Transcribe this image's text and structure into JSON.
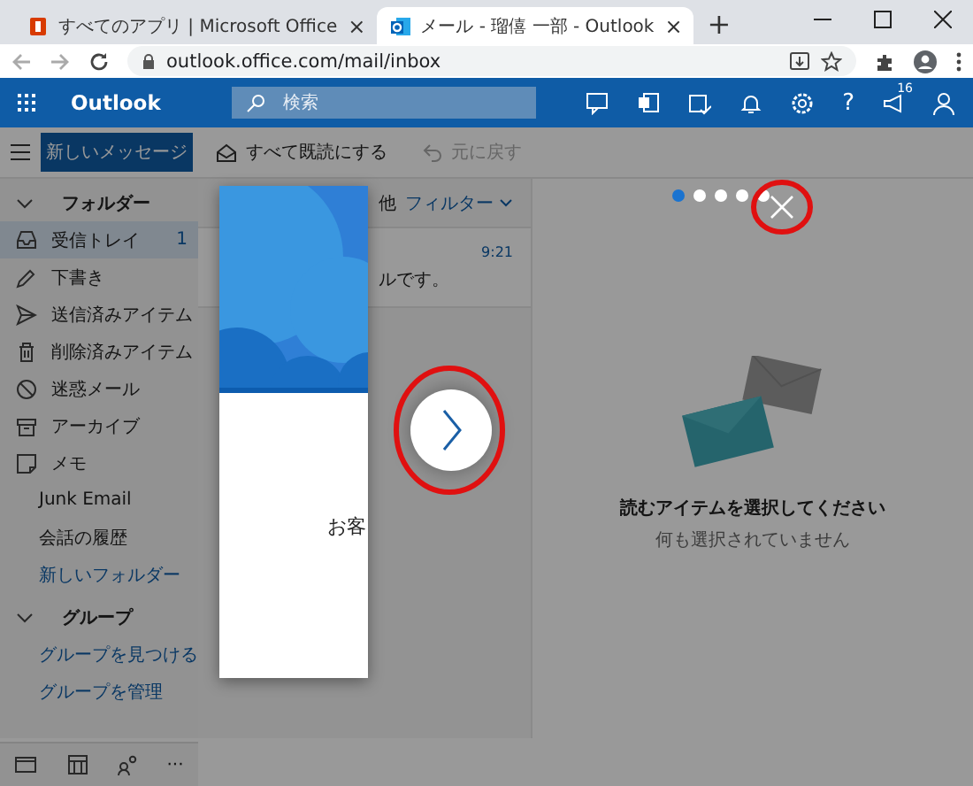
{
  "browser": {
    "tabs": [
      {
        "title": "すべてのアプリ | Microsoft Office",
        "close": "×",
        "selected": false
      },
      {
        "title": "メール - 瑠僖 一部 - Outlook",
        "close": "×",
        "selected": true
      }
    ],
    "new_tab": "+",
    "url": "outlook.office.com/mail/inbox"
  },
  "header": {
    "app_name": "Outlook",
    "search": {
      "placeholder": "検索"
    },
    "notification_badge": "16",
    "help": "?"
  },
  "toolbar": {
    "new_message": "新しいメッセージ",
    "mark_all_read": "すべて既読にする",
    "undo": {
      "label": "元に戻す",
      "disabled": true
    }
  },
  "folders": {
    "heading": "フォルダー",
    "expanded": true,
    "items": [
      {
        "label": "受信トレイ",
        "count": "1",
        "selected": true
      },
      {
        "label": "下書き",
        "selected": false
      },
      {
        "label": "送信済みアイテム",
        "selected": false
      },
      {
        "label": "削除済みアイテム",
        "selected": false
      },
      {
        "label": "迷惑メール",
        "selected": false
      },
      {
        "label": "アーカイブ",
        "selected": false
      },
      {
        "label": "メモ",
        "selected": false
      },
      {
        "label": "Junk Email",
        "selected": false
      },
      {
        "label": "会話の履歴",
        "selected": false
      },
      {
        "label": "新しいフォルダー",
        "selected": false,
        "kind": "action"
      }
    ]
  },
  "groups": {
    "heading": "グループ",
    "expanded": true,
    "items": [
      {
        "label": "グループを見つける",
        "kind": "action"
      },
      {
        "label": "グループを管理",
        "kind": "action"
      }
    ]
  },
  "bottom_bar": {
    "more": "···"
  },
  "message_list": {
    "header": "他",
    "filter": "フィルター",
    "messages": [
      {
        "time": "9:21",
        "preview": "ルです。"
      }
    ]
  },
  "reading_pane": {
    "title": "読むアイテムを選択してください",
    "subtitle": "何も選択されていません"
  },
  "tour": {
    "text": "お客",
    "steps": [
      {
        "selected": true
      },
      {
        "selected": false
      },
      {
        "selected": false
      },
      {
        "selected": false
      },
      {
        "selected": false
      }
    ]
  }
}
